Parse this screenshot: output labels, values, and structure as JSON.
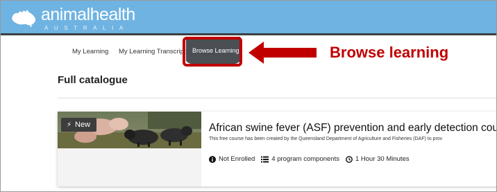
{
  "brand": {
    "name": "animalhealth",
    "sub": "AUSTRALIA",
    "colors": {
      "bar": "#6fb3e2",
      "accent_dark": "#3a3f44"
    }
  },
  "nav": {
    "items": [
      "My Learning",
      "My Learning Transcript"
    ],
    "active": "Browse Learning"
  },
  "annotation": {
    "callout": "Browse learning",
    "color": "#c00000"
  },
  "page": {
    "title": "Full catalogue"
  },
  "course": {
    "badge": "New",
    "title": "African swine fever (ASF) prevention and early detection course",
    "description": "This free course has been created by the Queensland Department of Agriculture and Fisheries (DAF) to prov",
    "status": "Not Enrolled",
    "components": "4 program components",
    "duration": "1 Hour 30 Minutes",
    "icons": [
      "info-icon",
      "list-icon",
      "clock-icon",
      "lightning-icon"
    ]
  }
}
